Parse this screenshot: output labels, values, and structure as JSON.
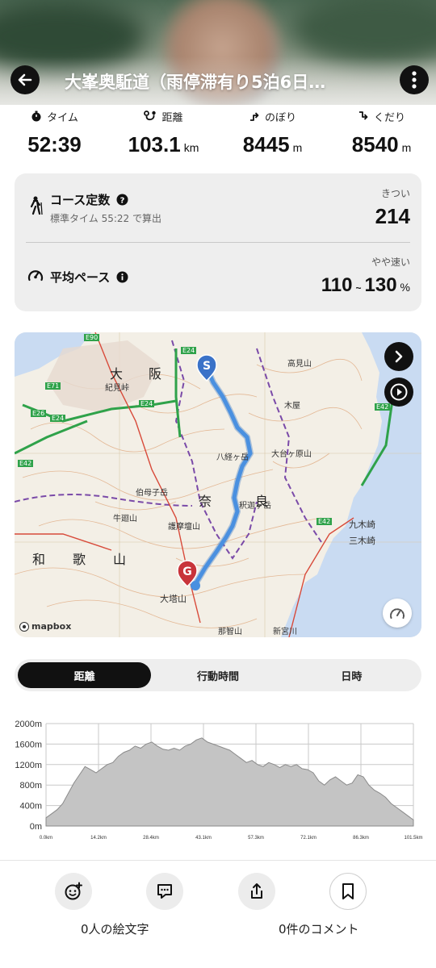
{
  "header": {
    "title": "大峯奥駈道（雨停滞有り5泊6日…"
  },
  "stats": [
    {
      "label": "タイム",
      "value": "52:39",
      "unit": "",
      "icon": "stopwatch-icon"
    },
    {
      "label": "距離",
      "value": "103.1",
      "unit": "km",
      "icon": "route-icon"
    },
    {
      "label": "のぼり",
      "value": "8445",
      "unit": "m",
      "icon": "ascent-icon"
    },
    {
      "label": "くだり",
      "value": "8540",
      "unit": "m",
      "icon": "descent-icon"
    }
  ],
  "course": {
    "label": "コース定数",
    "sub": "標準タイム 55:22 で算出",
    "note": "きつい",
    "value": "214"
  },
  "pace": {
    "label": "平均ペース",
    "note": "やや速い",
    "min": "110",
    "sep": "~",
    "max": "130",
    "unit": "%"
  },
  "map": {
    "attribution": "mapbox",
    "labels": [
      "大",
      "阪",
      "奈",
      "良",
      "和",
      "歌",
      "山",
      "九木崎",
      "三木崎",
      "新宮川",
      "大塔山",
      "那智山",
      "伯母子岳",
      "八経ヶ岳",
      "釈迦ヶ岳",
      "大台ヶ原山",
      "木屋",
      "高見山",
      "紀見峠",
      "護摩壇山",
      "牛廻山"
    ],
    "roads": [
      "E90",
      "E24",
      "E71",
      "E26",
      "E24",
      "E42",
      "E42",
      "E42",
      "E24"
    ],
    "start_marker": "S",
    "goal_marker": "G"
  },
  "tabs": {
    "items": [
      "距離",
      "行動時間",
      "日時"
    ],
    "active": 0
  },
  "elevation": {
    "y_ticks": [
      "2000m",
      "1600m",
      "1200m",
      "800m",
      "400m",
      "0m"
    ],
    "x_ticks": [
      "0.0km",
      "14.2km",
      "28.4km",
      "43.1km",
      "57.3km",
      "72.1km",
      "86.3km",
      "101.5km"
    ]
  },
  "bottom": {
    "emoji_count_text": "0人の絵文字",
    "comment_count_text": "0件のコメント"
  },
  "colors": {
    "accent": "#111111",
    "route": "#3a86d8",
    "start": "#3a72c8",
    "goal": "#c8343a"
  }
}
